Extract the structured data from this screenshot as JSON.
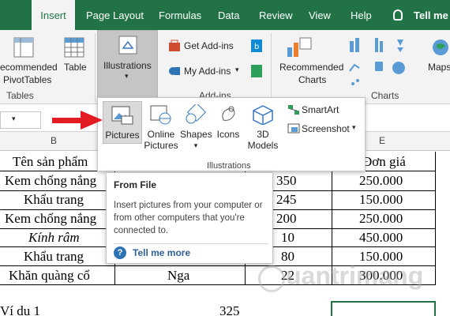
{
  "tabs": [
    {
      "label": "Insert",
      "active": true
    },
    {
      "label": "Page Layout"
    },
    {
      "label": "Formulas"
    },
    {
      "label": "Data"
    },
    {
      "label": "Review"
    },
    {
      "label": "View"
    },
    {
      "label": "Help"
    }
  ],
  "tell_me": "Tell me w",
  "ribbon": {
    "recommended_pivot": [
      "ecommended",
      "PivotTables"
    ],
    "table": "Table",
    "tables_group": "Tables",
    "illustrations": "Illustrations",
    "get_addins": "Get Add-ins",
    "my_addins": "My Add-ins",
    "addins_group": "Add-ins",
    "recommended_charts": [
      "Recommended",
      "Charts"
    ],
    "charts_group": "Charts",
    "maps": "Maps"
  },
  "panel": {
    "items": [
      {
        "label": "Pictures",
        "icon": "pictures-icon"
      },
      {
        "label": "Online Pictures",
        "icon": "online-pictures-icon"
      },
      {
        "label": "Shapes",
        "icon": "shapes-icon"
      },
      {
        "label": "Icons",
        "icon": "icons-icon"
      },
      {
        "label": "3D Models",
        "icon": "3d-models-icon"
      }
    ],
    "smartart": "SmartArt",
    "screenshot": "Screenshot",
    "group_label": "Illustrations"
  },
  "tooltip": {
    "title": "From File",
    "body": "Insert pictures from your computer or from other computers that you're connected to.",
    "link": "Tell me more"
  },
  "grid": {
    "columns": [
      "B",
      "E"
    ],
    "header": [
      "Tên sản phẩm",
      "Đơn giá"
    ],
    "rows": [
      {
        "name": "Kem chống nắng",
        "qty": "350",
        "price": "250.000"
      },
      {
        "name": "Khẩu trang",
        "qty": "245",
        "price": "150.000"
      },
      {
        "name": "Kem chống nắng",
        "qty": "200",
        "price": "250.000"
      },
      {
        "name": "Kính râm",
        "qty": "10",
        "price": "450.000"
      },
      {
        "name": "Khẩu trang",
        "qty": "80",
        "price": "150.000"
      },
      {
        "name": "Khăn quàng cổ",
        "person": "Nga",
        "qty": "22",
        "price": "300.000"
      }
    ],
    "footer_label": "Ví dụ 1",
    "footer_value": "325"
  },
  "watermark": "uantrimang",
  "colors": {
    "accent": "#217346",
    "arrow": "#e31b23"
  }
}
